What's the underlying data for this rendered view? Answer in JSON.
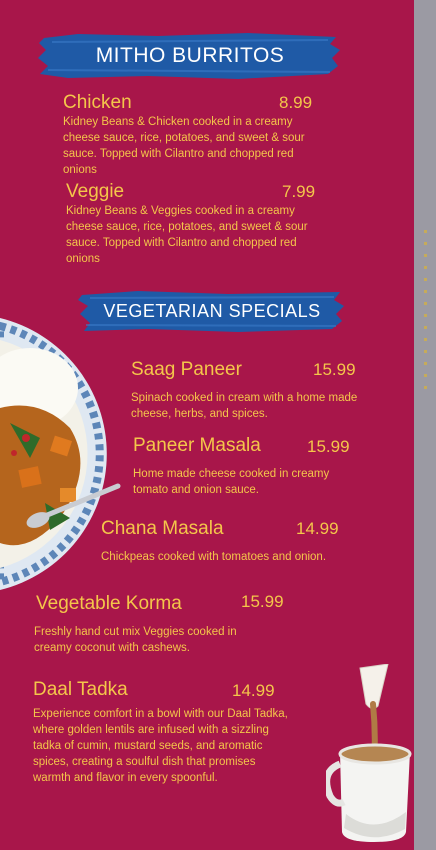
{
  "sections": [
    {
      "title": "MITHO BURRITOS"
    },
    {
      "title": "VEGETARIAN SPECIALS"
    }
  ],
  "items": [
    {
      "name": "Chicken",
      "price": "8.99",
      "desc": "Kidney Beans & Chicken cooked in a creamy cheese sauce, rice, potatoes, and sweet & sour sauce. Topped with Cilantro and chopped red onions"
    },
    {
      "name": "Veggie",
      "price": "7.99",
      "desc": "Kidney Beans & Veggies cooked in a creamy cheese sauce, rice, potatoes, and sweet & sour sauce. Topped with Cilantro and chopped red onions"
    },
    {
      "name": "Saag Paneer",
      "price": "15.99",
      "desc": "Spinach cooked in cream with a home made cheese, herbs, and spices."
    },
    {
      "name": "Paneer Masala",
      "price": "15.99",
      "desc": "Home made cheese cooked in creamy tomato and onion sauce."
    },
    {
      "name": "Chana Masala",
      "price": "14.99",
      "desc": "Chickpeas cooked with tomatoes and onion."
    },
    {
      "name": "Vegetable Korma",
      "price": "15.99",
      "desc": "Freshly hand cut mix Veggies cooked in creamy coconut with cashews."
    },
    {
      "name": "Daal Tadka",
      "price": "14.99",
      "desc": "Experience comfort in a bowl with our Daal Tadka, where golden lentils are infused with a sizzling tadka of cumin, mustard seeds, and aromatic spices, creating a soulful dish that promises warmth and flavor in every spoonful."
    }
  ],
  "colors": {
    "background": "#a8164a",
    "text": "#f4c64a",
    "banner": "#1f5aa6",
    "banner_text": "#ffffff"
  },
  "icons": [
    "curry-plate-image",
    "chai-cup-image"
  ]
}
